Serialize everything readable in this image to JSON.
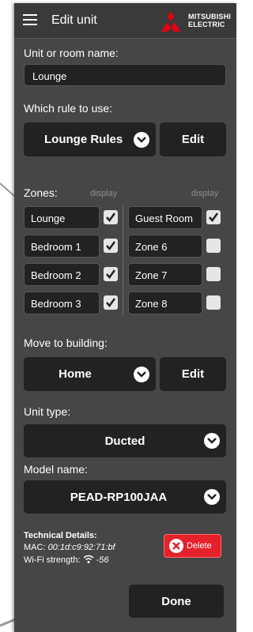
{
  "header": {
    "title": "Edit unit",
    "brand_line1": "MITSUBISHI",
    "brand_line2": "ELECTRIC"
  },
  "unit_name": {
    "label": "Unit or room name:",
    "value": "Lounge"
  },
  "rule": {
    "label": "Which rule to use:",
    "selected": "Lounge Rules",
    "edit_label": "Edit"
  },
  "zones": {
    "label": "Zones:",
    "display_hint_left": "display",
    "display_hint_right": "display",
    "left": [
      {
        "name": "Lounge",
        "checked": true
      },
      {
        "name": "Bedroom 1",
        "checked": true
      },
      {
        "name": "Bedroom 2",
        "checked": true
      },
      {
        "name": "Bedroom 3",
        "checked": true
      }
    ],
    "right": [
      {
        "name": "Guest Room",
        "checked": true
      },
      {
        "name": "Zone 6",
        "checked": false
      },
      {
        "name": "Zone 7",
        "checked": false
      },
      {
        "name": "Zone 8",
        "checked": false
      }
    ]
  },
  "building": {
    "label": "Move to building:",
    "selected": "Home",
    "edit_label": "Edit"
  },
  "unit_type": {
    "label": "Unit type:",
    "selected": "Ducted"
  },
  "model": {
    "label": "Model name:",
    "selected": "PEAD-RP100JAA"
  },
  "technical": {
    "heading": "Technical Details:",
    "mac_label": "MAC:",
    "mac_value": "00:1d:c9:92:71:bf",
    "wifi_label": "Wi-Fi strength:",
    "wifi_value": "-56"
  },
  "actions": {
    "delete_label": "Delete",
    "done_label": "Done"
  },
  "colors": {
    "panel": "#464646",
    "field": "#222222",
    "delete": "#e5212a",
    "brand_red": "#e60012"
  }
}
